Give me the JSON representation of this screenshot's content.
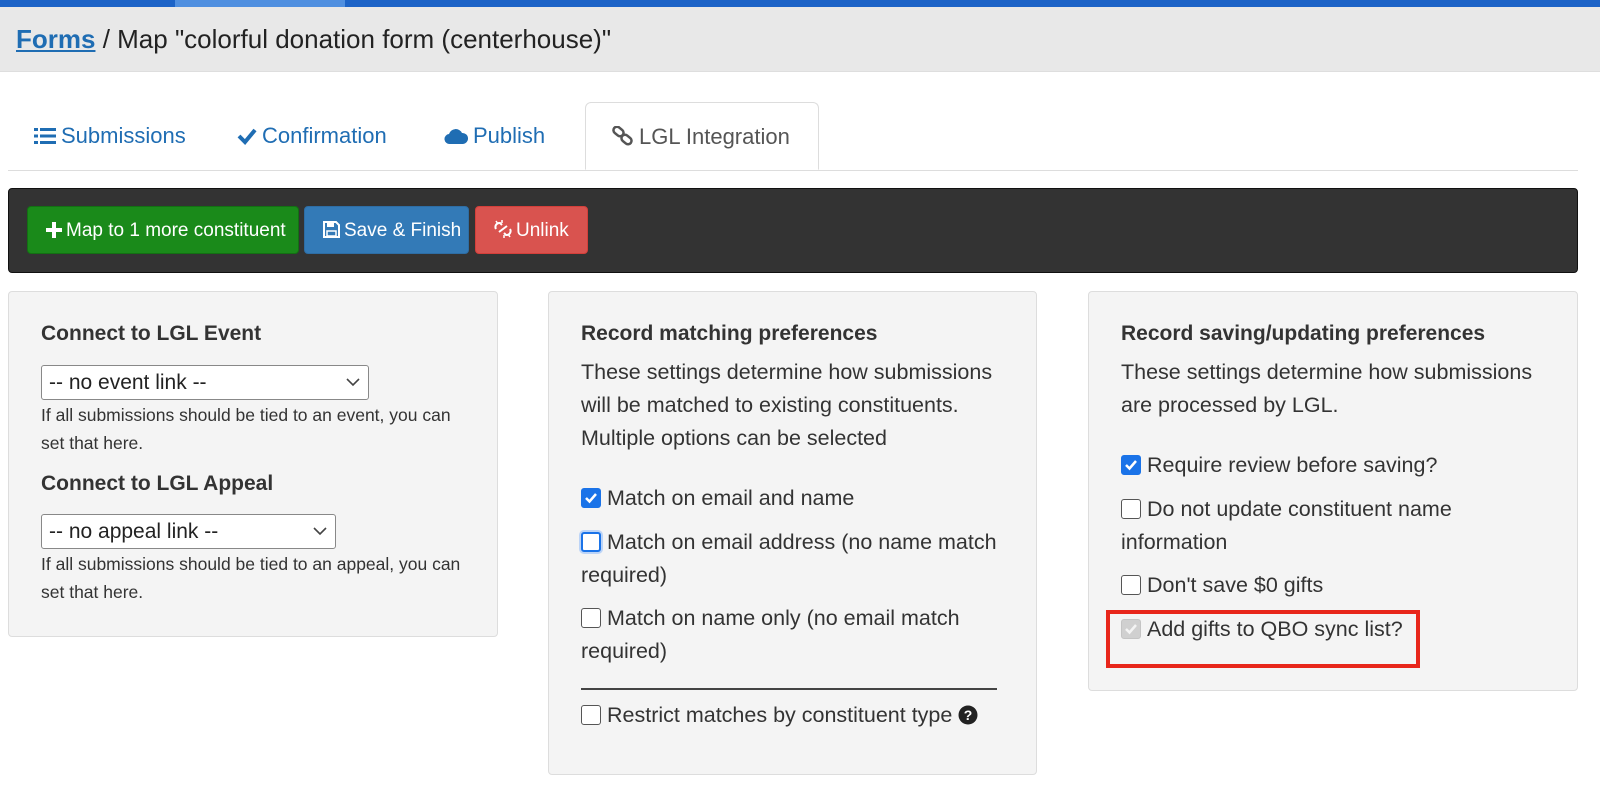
{
  "header": {
    "breadcrumb_link": "Forms",
    "breadcrumb_rest": " / Map \"colorful donation form (centerhouse)\""
  },
  "tabs": [
    {
      "label": "Submissions",
      "icon": "list-icon"
    },
    {
      "label": "Confirmation",
      "icon": "check-icon"
    },
    {
      "label": "Publish",
      "icon": "cloud-icon"
    },
    {
      "label": "LGL Integration",
      "icon": "link-icon",
      "active": true
    }
  ],
  "toolbar": {
    "map_label": "Map to 1 more constituent",
    "save_label": "Save & Finish",
    "unlink_label": "Unlink"
  },
  "event_panel": {
    "event_heading": "Connect to LGL Event",
    "event_select": "-- no event link --",
    "event_help": "If all submissions should be tied to an event, you can set that here.",
    "appeal_heading": "Connect to LGL Appeal",
    "appeal_select": "-- no appeal link --",
    "appeal_help": "If all submissions should be tied to an appeal, you can set that here."
  },
  "matching_panel": {
    "heading": "Record matching preferences",
    "description": "These settings determine how submissions will be matched to existing constituents. Multiple options can be selected",
    "options": [
      {
        "label": "Match on email and name",
        "checked": true
      },
      {
        "label": "Match on email address (no name match required)",
        "checked": false
      },
      {
        "label": "Match on name only (no email match required)",
        "checked": false
      }
    ],
    "restrict_label": "Restrict matches by constituent type",
    "restrict_checked": false
  },
  "saving_panel": {
    "heading": "Record saving/updating preferences",
    "description": "These settings determine how submissions are processed by LGL.",
    "options": [
      {
        "label": "Require review before saving?",
        "checked": true
      },
      {
        "label": "Do not update constituent name information",
        "checked": false
      },
      {
        "label": "Don't save $0 gifts",
        "checked": false
      },
      {
        "label": "Add gifts to QBO sync list?",
        "checked": true,
        "disabled": true
      }
    ]
  },
  "colors": {
    "accent_blue": "#1f6db3",
    "success_green": "#1a8a1a",
    "primary_blue": "#337ab7",
    "danger_red": "#d9534f",
    "highlight_red": "#e8261b"
  }
}
